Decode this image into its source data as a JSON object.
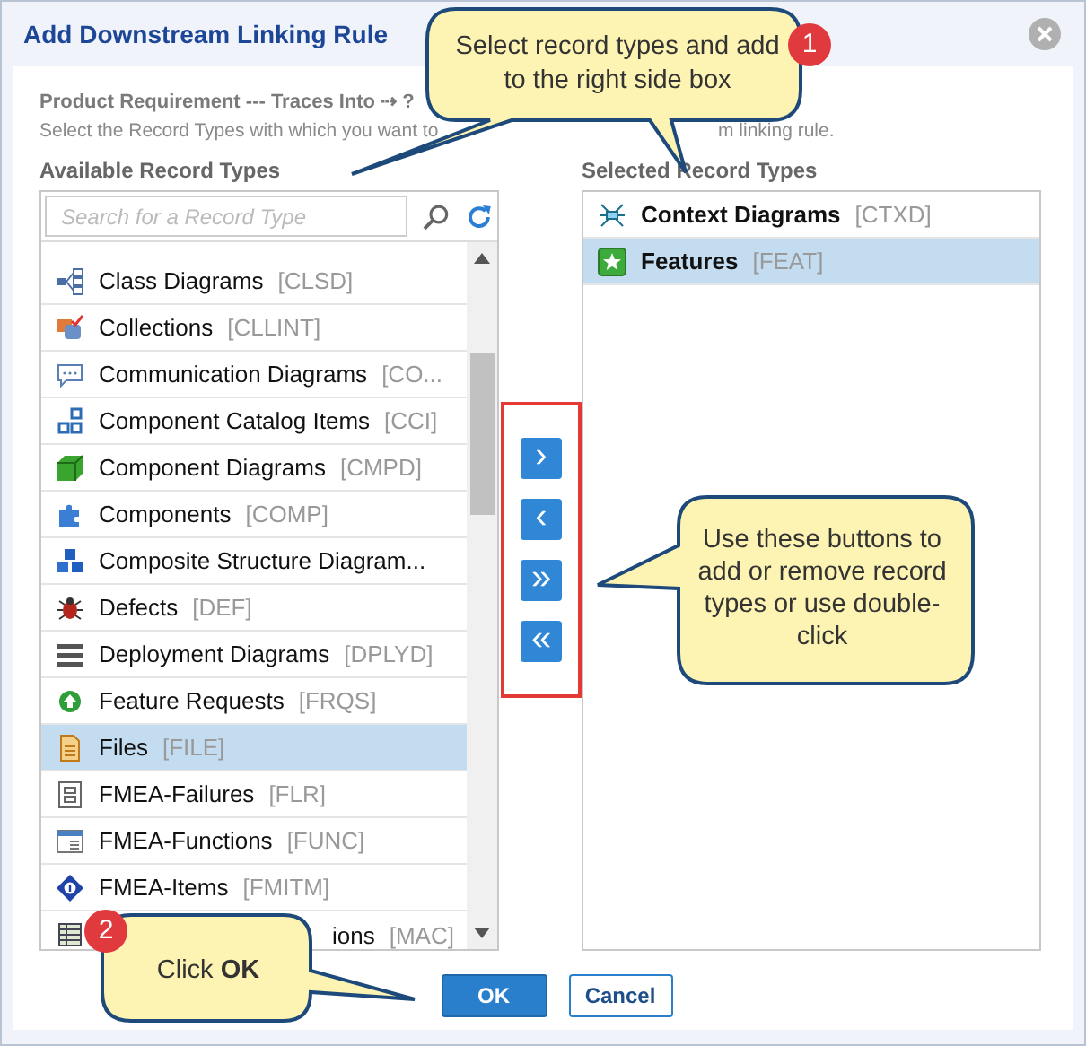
{
  "dialog": {
    "title": "Add Downstream Linking Rule"
  },
  "rule": "Product Requirement --- Traces Into ⇢ ?",
  "description": [
    "Select the Record Types with which you want to",
    "m linking rule."
  ],
  "available": {
    "label": "Available Record Types",
    "search_placeholder": "Search for a Record Type",
    "items": [
      {
        "name": "Class Diagrams",
        "code": "[CLSD]",
        "selected": false
      },
      {
        "name": "Collections",
        "code": "[CLLINT]",
        "selected": false
      },
      {
        "name": "Communication Diagrams",
        "code": "[CO...",
        "selected": false
      },
      {
        "name": "Component Catalog Items",
        "code": "[CCI]",
        "selected": false
      },
      {
        "name": "Component Diagrams",
        "code": "[CMPD]",
        "selected": false
      },
      {
        "name": "Components",
        "code": "[COMP]",
        "selected": false
      },
      {
        "name": "Composite Structure Diagram...",
        "selected": false
      },
      {
        "name": "Defects",
        "code": "[DEF]",
        "selected": false
      },
      {
        "name": "Deployment Diagrams",
        "code": "[DPLYD]",
        "selected": false
      },
      {
        "name": "Feature Requests",
        "code": "[FRQS]",
        "selected": false
      },
      {
        "name": "Files",
        "code": "[FILE]",
        "selected": true
      },
      {
        "name": "FMEA-Failures",
        "code": "[FLR]",
        "selected": false
      },
      {
        "name": "FMEA-Functions",
        "code": "[FUNC]",
        "selected": false
      },
      {
        "name": "FMEA-Items",
        "code": "[FMITM]",
        "selected": false
      }
    ],
    "partial_item": {
      "name": "ions",
      "code": "[MAC]"
    }
  },
  "selected_types": {
    "label": "Selected Record Types",
    "items": [
      {
        "name": "Context Diagrams",
        "code": "[CTXD]",
        "selected": false
      },
      {
        "name": "Features",
        "code": "[FEAT]",
        "selected": true
      }
    ]
  },
  "move_buttons": [
    "›",
    "‹",
    "»",
    "«"
  ],
  "buttons": {
    "ok": "OK",
    "cancel": "Cancel"
  },
  "callouts": [
    {
      "badge": "1",
      "text": "Select record types and add to the right side box"
    },
    {
      "text": "Use these buttons to add or remove record types or use double-click"
    },
    {
      "badge": "2",
      "text": "Click **OK**"
    }
  ]
}
